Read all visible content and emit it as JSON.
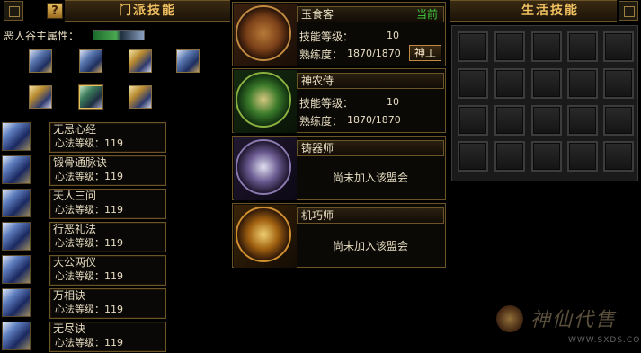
{
  "left": {
    "title": "门派技能",
    "help_label": "?",
    "attr_label": "恶人谷主属性：",
    "skills": [
      {
        "name": "无忌心经",
        "level": "心法等级：119"
      },
      {
        "name": "锻骨通脉诀",
        "level": "心法等级：119"
      },
      {
        "name": "天人三问",
        "level": "心法等级：119"
      },
      {
        "name": "行恶礼法",
        "level": "心法等级：119"
      },
      {
        "name": "大公两仪",
        "level": "心法等级：119"
      },
      {
        "name": "万相诀",
        "level": "心法等级：119"
      },
      {
        "name": "无尽诀",
        "level": "心法等级：119"
      }
    ]
  },
  "middle": {
    "professions": [
      {
        "name": "玉食客",
        "status": "当前",
        "skill_level_label": "技能等级：",
        "skill_level": "10",
        "proficiency_label": "熟练度：",
        "proficiency": "1870/1870",
        "button": "神工"
      },
      {
        "name": "神农侍",
        "skill_level_label": "技能等级：",
        "skill_level": "10",
        "proficiency_label": "熟练度：",
        "proficiency": "1870/1870"
      },
      {
        "name": "铸器师",
        "message": "尚未加入该盟会"
      },
      {
        "name": "机巧师",
        "message": "尚未加入该盟会"
      }
    ]
  },
  "right": {
    "title": "生活技能",
    "help_label": "?"
  },
  "watermark": {
    "text": "神仙代售",
    "url": "WWW.SXDS.COM"
  },
  "colors": {
    "accent": "#f0c060",
    "current": "#40d040",
    "border": "#6b5426"
  }
}
